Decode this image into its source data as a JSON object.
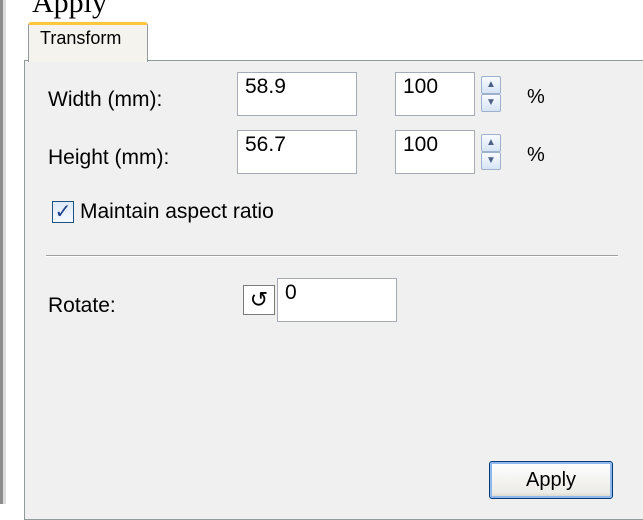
{
  "header": {
    "clipped_title": "Apply"
  },
  "tabs": [
    {
      "label": "Transform"
    }
  ],
  "transform": {
    "width": {
      "label": "Width (mm):",
      "value": "58.9",
      "percent": "100",
      "unit": "%"
    },
    "height": {
      "label": "Height (mm):",
      "value": "56.7",
      "percent": "100",
      "unit": "%"
    },
    "aspect": {
      "label": "Maintain aspect ratio",
      "checked": true
    },
    "rotate": {
      "label": "Rotate:",
      "value": "0"
    }
  },
  "icons": {
    "spin_up": "spin-up-arrow-icon",
    "spin_down": "spin-down-arrow-icon",
    "checkmark": "checkmark-icon",
    "rotate": "rotate-counterclockwise-icon"
  },
  "buttons": {
    "apply": "Apply"
  },
  "colors": {
    "panel": "#f0f0f0",
    "tab_accent": "#ffc83c",
    "button_border": "#003c74"
  }
}
